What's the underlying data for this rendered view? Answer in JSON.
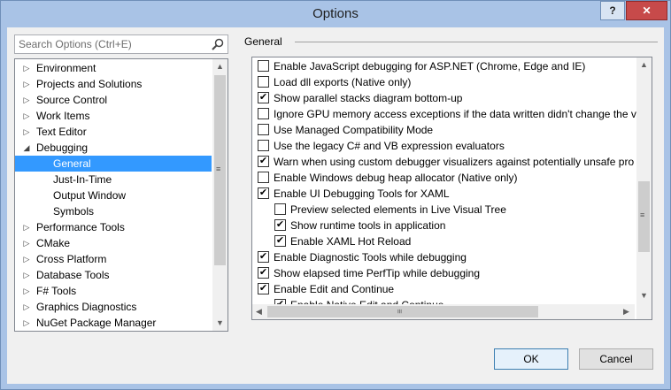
{
  "window": {
    "title": "Options",
    "help_label": "?",
    "close_label": "✕"
  },
  "search": {
    "placeholder": "Search Options (Ctrl+E)"
  },
  "tree": {
    "items": [
      {
        "label": "Environment",
        "arrow": "▷"
      },
      {
        "label": "Projects and Solutions",
        "arrow": "▷"
      },
      {
        "label": "Source Control",
        "arrow": "▷"
      },
      {
        "label": "Work Items",
        "arrow": "▷"
      },
      {
        "label": "Text Editor",
        "arrow": "▷"
      },
      {
        "label": "Debugging",
        "arrow": "◢"
      },
      {
        "label": "General",
        "arrow": ""
      },
      {
        "label": "Just-In-Time",
        "arrow": ""
      },
      {
        "label": "Output Window",
        "arrow": ""
      },
      {
        "label": "Symbols",
        "arrow": ""
      },
      {
        "label": "Performance Tools",
        "arrow": "▷"
      },
      {
        "label": "CMake",
        "arrow": "▷"
      },
      {
        "label": "Cross Platform",
        "arrow": "▷"
      },
      {
        "label": "Database Tools",
        "arrow": "▷"
      },
      {
        "label": "F# Tools",
        "arrow": "▷"
      },
      {
        "label": "Graphics Diagnostics",
        "arrow": "▷"
      },
      {
        "label": "NuGet Package Manager",
        "arrow": "▷"
      }
    ],
    "selected": "General"
  },
  "section": {
    "title": "General"
  },
  "options": [
    {
      "label": "Enable JavaScript debugging for ASP.NET (Chrome, Edge and IE)",
      "checked": false
    },
    {
      "label": "Load dll exports (Native only)",
      "checked": false
    },
    {
      "label": "Show parallel stacks diagram bottom-up",
      "checked": true
    },
    {
      "label": "Ignore GPU memory access exceptions if the data written didn't change the v",
      "checked": false
    },
    {
      "label": "Use Managed Compatibility Mode",
      "checked": false
    },
    {
      "label": "Use the legacy C# and VB expression evaluators",
      "checked": false
    },
    {
      "label": "Warn when using custom debugger visualizers against potentially unsafe pro",
      "checked": true
    },
    {
      "label": "Enable Windows debug heap allocator (Native only)",
      "checked": false
    },
    {
      "label": "Enable UI Debugging Tools for XAML",
      "checked": true
    },
    {
      "label": "Preview selected elements in Live Visual Tree",
      "checked": false
    },
    {
      "label": "Show runtime tools in application",
      "checked": true
    },
    {
      "label": "Enable XAML Hot Reload",
      "checked": true
    },
    {
      "label": "Enable Diagnostic Tools while debugging",
      "checked": true
    },
    {
      "label": "Show elapsed time PerfTip while debugging",
      "checked": true
    },
    {
      "label": "Enable Edit and Continue",
      "checked": true
    },
    {
      "label": "Enable Native Edit and Continue",
      "checked": true
    }
  ],
  "buttons": {
    "ok": "OK",
    "cancel": "Cancel"
  },
  "icons": {
    "search": "search-icon",
    "check": "✔"
  }
}
